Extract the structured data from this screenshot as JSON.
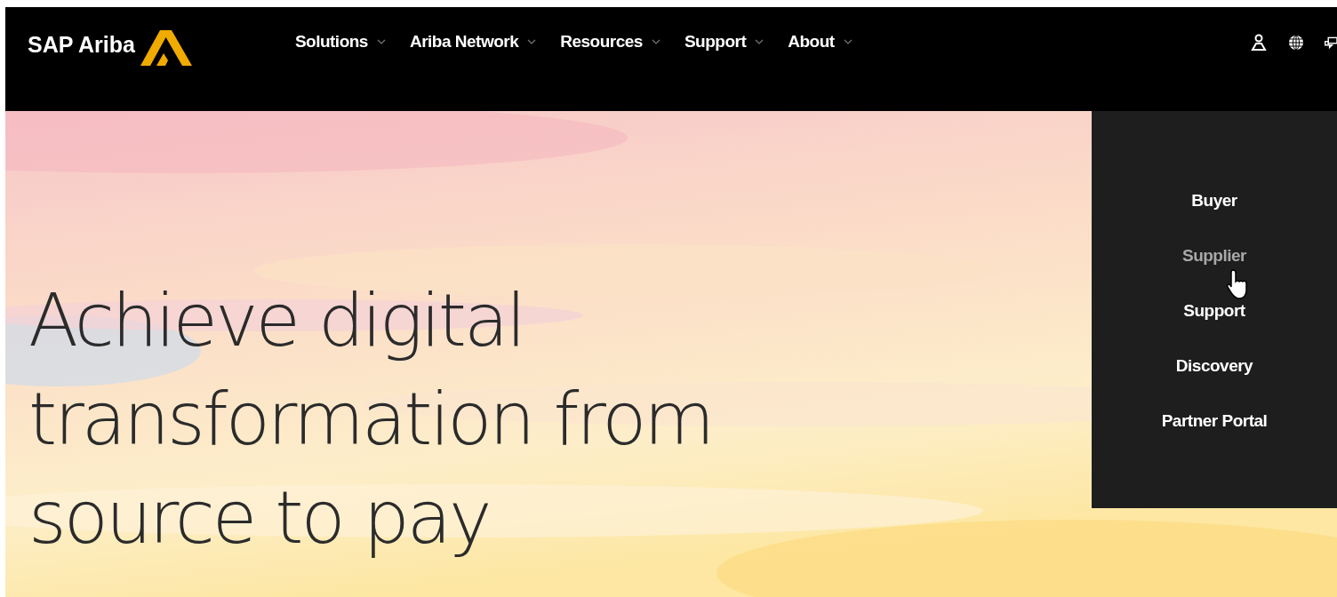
{
  "header": {
    "logo": "SAP Ariba",
    "nav": [
      {
        "label": "Solutions"
      },
      {
        "label": "Ariba Network"
      },
      {
        "label": "Resources"
      },
      {
        "label": "Support"
      },
      {
        "label": "About"
      }
    ]
  },
  "hero": {
    "headline": [
      "Achieve digital",
      "transformation from",
      "source to pay"
    ]
  },
  "dropdown": {
    "items": [
      {
        "label": "Buyer",
        "selected": false
      },
      {
        "label": "Supplier",
        "selected": true
      },
      {
        "label": "Support",
        "selected": false
      },
      {
        "label": "Discovery",
        "selected": false
      },
      {
        "label": "Partner Portal",
        "selected": false
      }
    ]
  }
}
